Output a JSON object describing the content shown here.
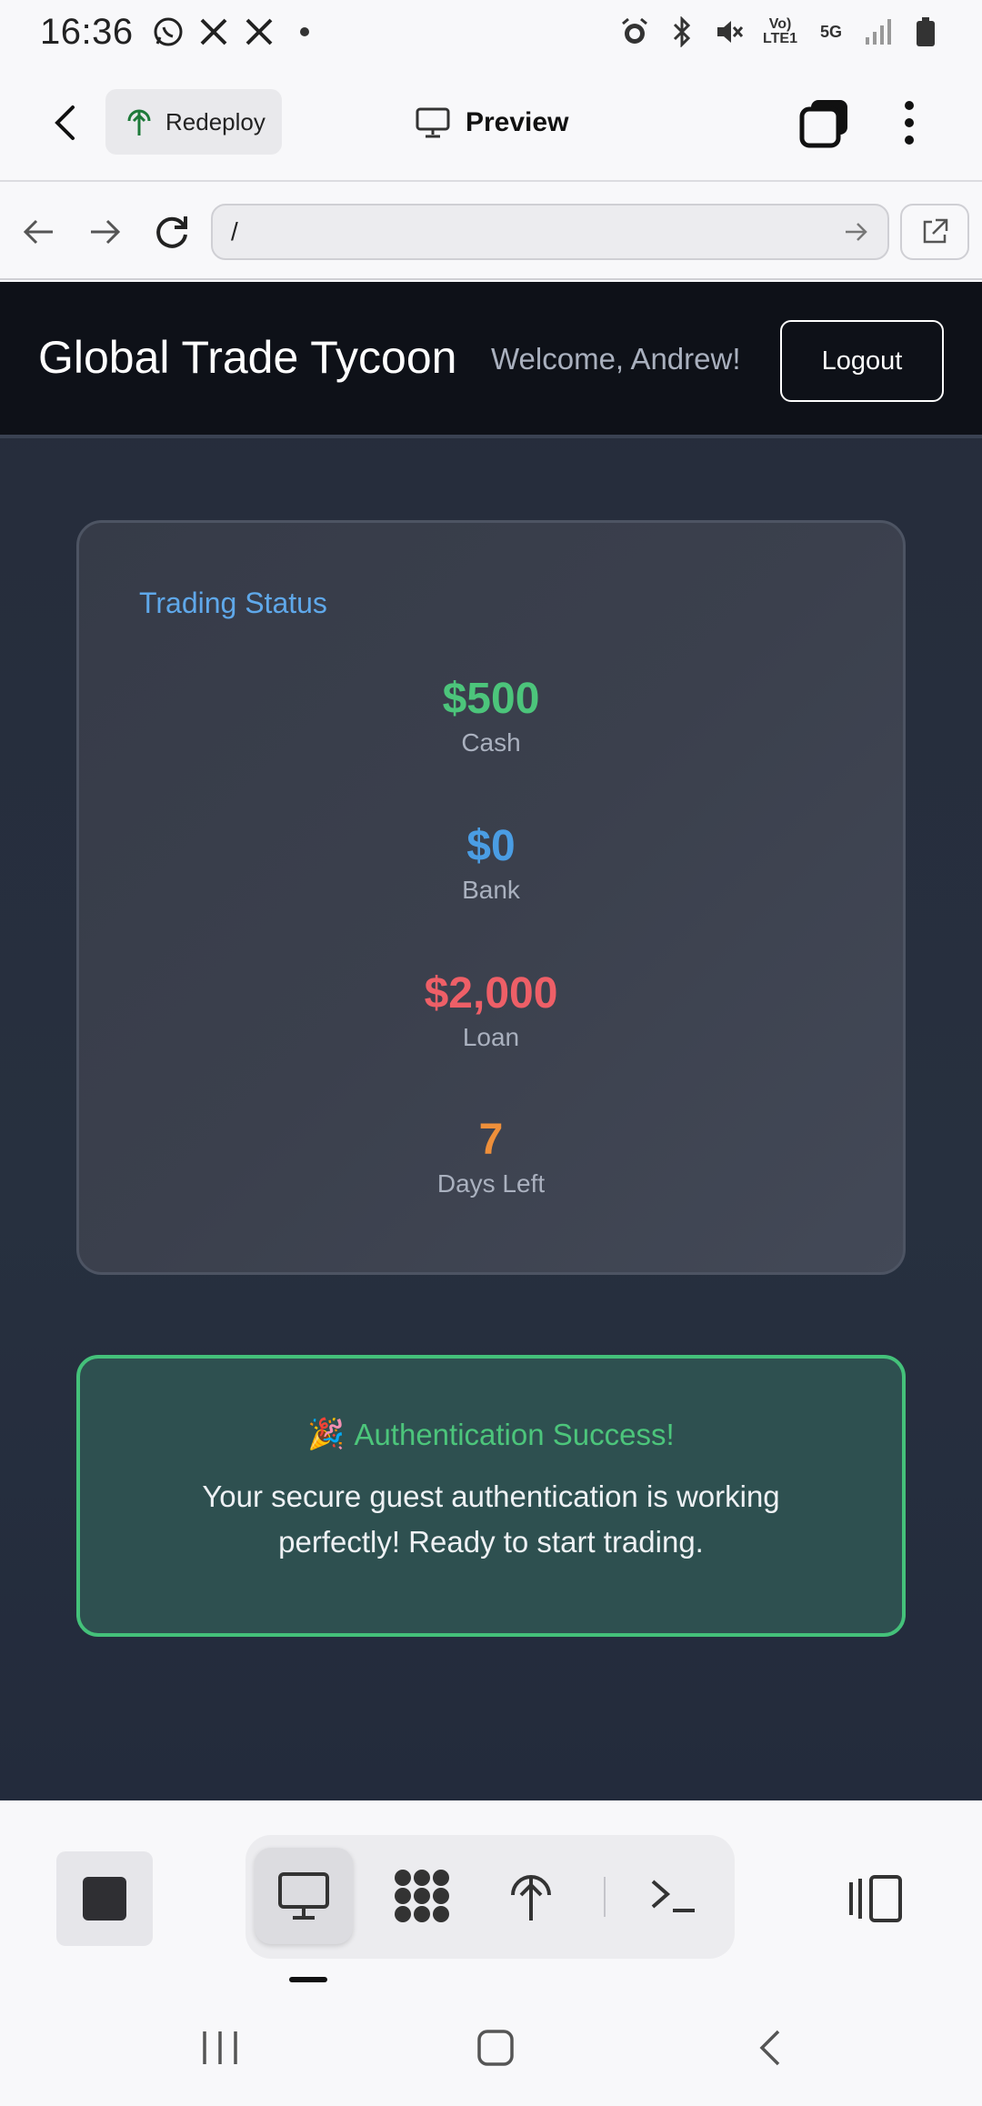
{
  "status_bar": {
    "time": "16:36",
    "left_icons": [
      "whatsapp-icon",
      "x-icon",
      "x-icon",
      "dot-icon"
    ],
    "right_icons": [
      "alarm-icon",
      "bluetooth-icon",
      "mute-icon",
      "volte-icon",
      "5g-icon",
      "signal-icon",
      "battery-icon"
    ],
    "volte_label": "Vo) LTE1",
    "network_label": "5G"
  },
  "app_bar": {
    "redeploy_label": "Redeploy",
    "preview_label": "Preview"
  },
  "url_bar": {
    "url": "/"
  },
  "site": {
    "title": "Global Trade Tycoon",
    "welcome": "Welcome, Andrew!",
    "logout_label": "Logout"
  },
  "trading_status": {
    "title": "Trading Status",
    "stats": [
      {
        "value": "$500",
        "label": "Cash",
        "color": "#4cc57b"
      },
      {
        "value": "$0",
        "label": "Bank",
        "color": "#4a9de4"
      },
      {
        "value": "$2,000",
        "label": "Loan",
        "color": "#ee5f67"
      },
      {
        "value": "7",
        "label": "Days Left",
        "color": "#ee8f3a"
      }
    ]
  },
  "success": {
    "emoji": "🎉",
    "title": "Authentication Success!",
    "message": "Your secure guest authentication is working perfectly! Ready to start trading."
  },
  "bottom_toolbar": {
    "tools": [
      "preview-icon",
      "apps-icon",
      "deploy-icon",
      "terminal-icon"
    ],
    "active_tool": "preview-icon"
  },
  "colors": {
    "accent_blue": "#5fa8ea",
    "success_green": "#4cc57b"
  }
}
